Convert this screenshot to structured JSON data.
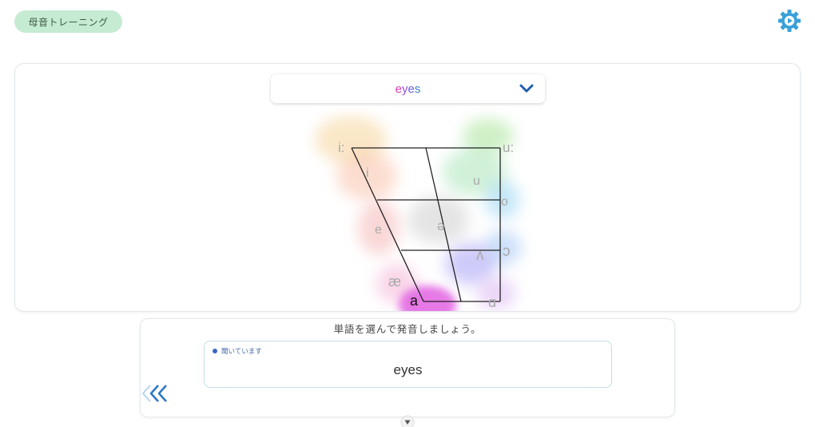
{
  "app": {
    "title": "母音トレーニング"
  },
  "header": {
    "settings_icon": "gear-icon",
    "accent": "#3aa0d8"
  },
  "word_select": {
    "selected": "eyes",
    "letters": [
      {
        "ch": "e",
        "color": "#d63fb8"
      },
      {
        "ch": "y",
        "color": "#9b4fd6"
      },
      {
        "ch": "e",
        "color": "#6a5fe0"
      },
      {
        "ch": "s",
        "color": "#3a7fd0"
      }
    ],
    "icon": "chevron-down-icon",
    "accent": "#1f5fb0"
  },
  "vowel_chart": {
    "vowels": [
      {
        "symbol": "i:",
        "color": "#f4c46a"
      },
      {
        "symbol": "i",
        "color": "#f6a77a"
      },
      {
        "symbol": "u",
        "color": "#7fd48a"
      },
      {
        "symbol": "u:",
        "color": "#9be07a"
      },
      {
        "symbol": "o",
        "color": "#7ec8ee"
      },
      {
        "symbol": "ə",
        "color": "#bdbdbd"
      },
      {
        "symbol": "e",
        "color": "#f09a9a"
      },
      {
        "symbol": "ɔ",
        "color": "#8ab7f0"
      },
      {
        "symbol": "ʌ",
        "color": "#8e86f0"
      },
      {
        "symbol": "æ",
        "color": "#f2a0c8"
      },
      {
        "symbol": "a",
        "color": "#d83fd8"
      },
      {
        "symbol": "ɑ",
        "color": "#c48ee8"
      }
    ],
    "active": "a"
  },
  "bottom": {
    "instruction": "単語を選んで発音しましょう。",
    "status": "聞いています",
    "recognized": "eyes",
    "back_icon": "double-chevron-left-icon",
    "down_icon": "triangle-down-icon"
  }
}
